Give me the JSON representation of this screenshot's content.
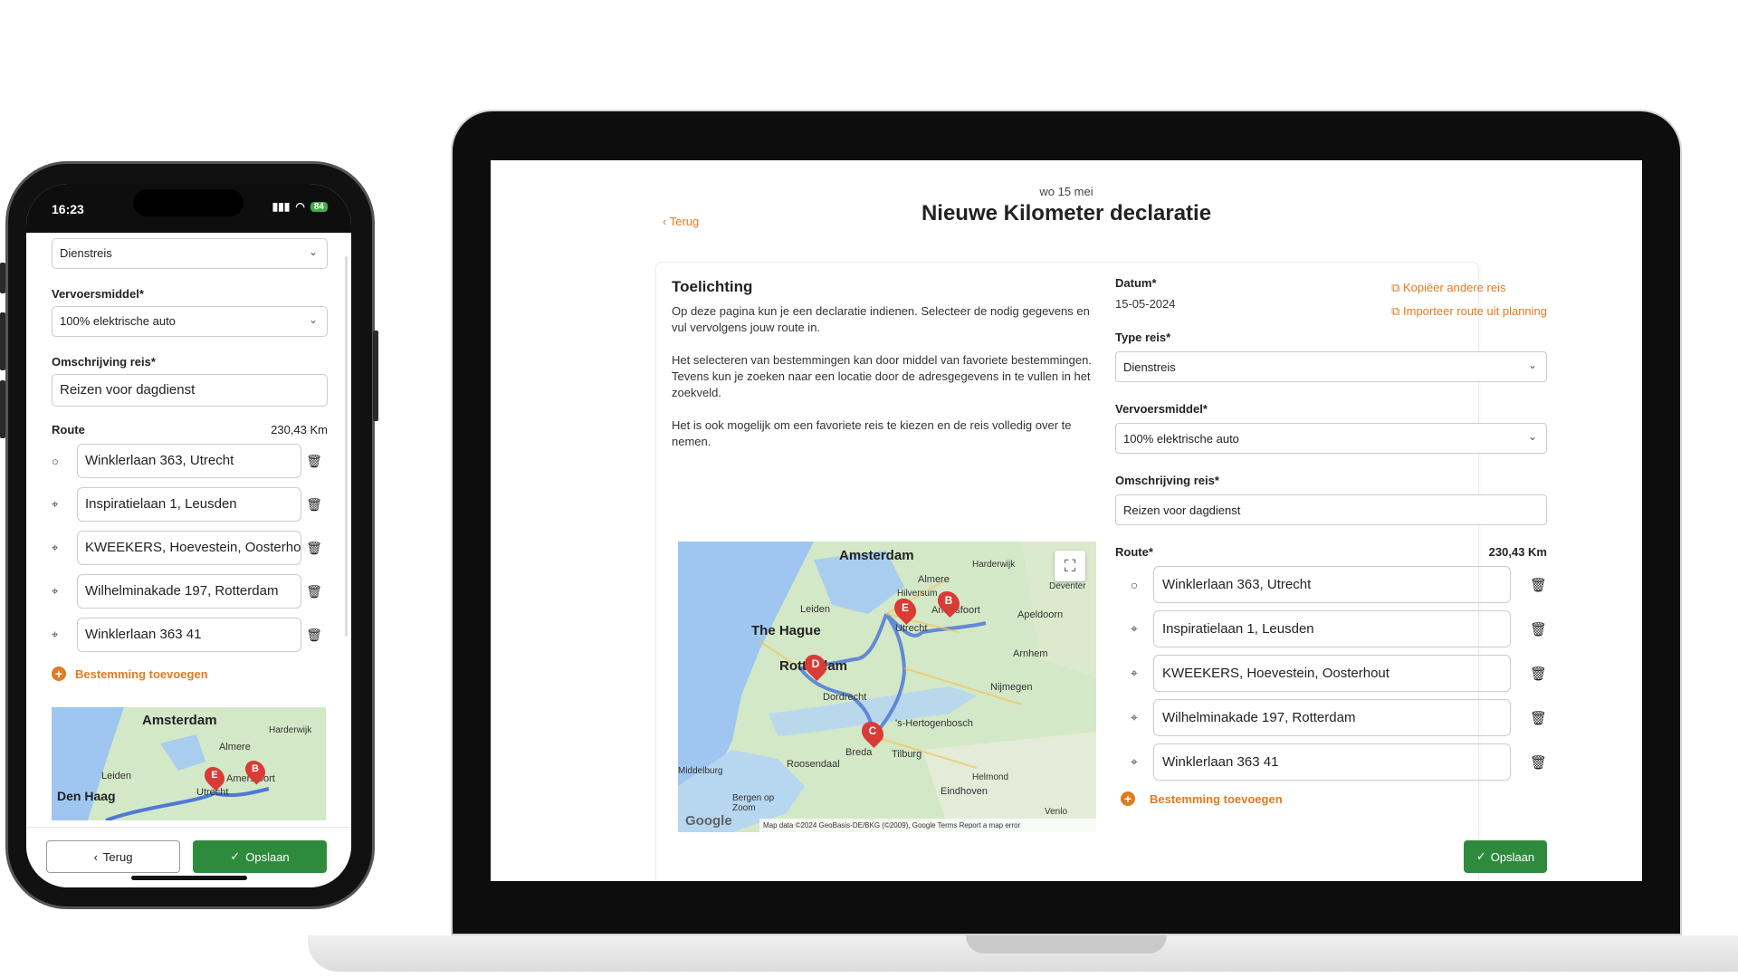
{
  "phone": {
    "status": {
      "time": "16:23",
      "battery": "84"
    },
    "fields": {
      "type_value": "Dienstreis",
      "vervoer_label": "Vervoersmiddel*",
      "vervoer_value": "100% elektrische auto",
      "omschrijving_label": "Omschrijving reis*",
      "omschrijving_value": "Reizen voor dagdienst"
    },
    "route": {
      "label": "Route",
      "distance": "230,43 Km",
      "stops": [
        "Winklerlaan 363, Utrecht",
        "Inspiratielaan 1, Leusden",
        "KWEEKERS, Hoevestein, Oosterhout",
        "Wilhelminakade 197, Rotterdam",
        "Winklerlaan 363 41"
      ],
      "add_label": "Bestemming toevoegen"
    },
    "map": {
      "cities": [
        "Amsterdam",
        "Almere",
        "Harderwijk",
        "Leiden",
        "Den Haag",
        "Utrecht",
        "Amersfoort"
      ],
      "markers": [
        "E",
        "B"
      ]
    },
    "footer": {
      "back_label": "Terug",
      "save_label": "Opslaan"
    }
  },
  "laptop": {
    "header": {
      "date": "wo 15 mei",
      "title": "Nieuwe Kilometer declaratie",
      "back_label": "Terug"
    },
    "toelichting": {
      "heading": "Toelichting",
      "paragraphs": [
        "Op deze pagina kun je een declaratie indienen. Selecteer de nodig gegevens en vul vervolgens jouw route in.",
        "Het selecteren van bestemmingen kan door middel van favoriete bestemmingen. Tevens kun je zoeken naar een locatie door de adresgegevens in te vullen in het zoekveld.",
        "Het is ook mogelijk om een favoriete reis te kiezen en de reis volledig over te nemen."
      ]
    },
    "form": {
      "datum_label": "Datum*",
      "datum_value": "15-05-2024",
      "copy_link": "Kopiëer andere reis",
      "import_link": "Importeer route uit planning",
      "type_label": "Type reis*",
      "type_value": "Dienstreis",
      "vervoer_label": "Vervoersmiddel*",
      "vervoer_value": "100% elektrische auto",
      "omschrijving_label": "Omschrijving reis*",
      "omschrijving_value": "Reizen voor dagdienst",
      "route_label": "Route*",
      "route_distance": "230,43 Km",
      "stops": [
        "Winklerlaan 363, Utrecht",
        "Inspiratielaan 1, Leusden",
        "KWEEKERS, Hoevestein, Oosterhout",
        "Wilhelminakade 197, Rotterdam",
        "Winklerlaan 363 41"
      ],
      "add_label": "Bestemming toevoegen",
      "save_label": "Opslaan"
    },
    "map": {
      "cities": [
        "Amsterdam",
        "Almere",
        "Harderwijk",
        "Hilversum",
        "Leiden",
        "The Hague",
        "Utrecht",
        "Amersfoort",
        "Apeldoorn",
        "Deventer",
        "Rotterdam",
        "Arnhem",
        "Dordrecht",
        "Nijmegen",
        "'s-Hertogenbosch",
        "Breda",
        "Tilburg",
        "Roosendaal",
        "Helmond",
        "Eindhoven",
        "Bergen op Zoom",
        "Venlo",
        "Middelburg"
      ],
      "markers": [
        "E",
        "B",
        "D",
        "C"
      ],
      "attribution": "Map data ©2024 GeoBasis-DE/BKG (©2009), Google   Terms   Report a map error",
      "logo": "Google"
    }
  },
  "colors": {
    "accent": "#e07b22",
    "save_green": "#2e8b3d"
  }
}
